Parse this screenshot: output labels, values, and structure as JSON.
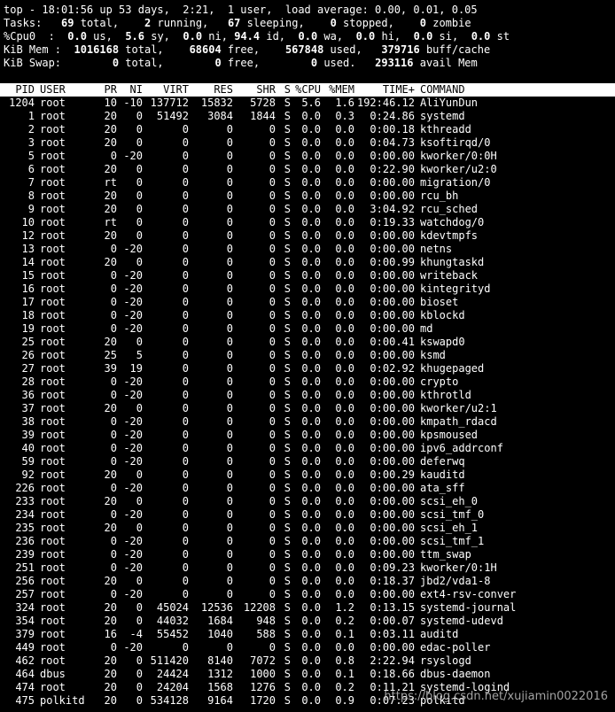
{
  "summary": {
    "line1": "top - 18:01:56 up 53 days,  2:21,  1 user,  load average: 0.00, 0.01, 0.05",
    "tasks": {
      "label": "Tasks:",
      "total": "69",
      "total_label": "total,",
      "running": "2",
      "running_label": "running,",
      "sleeping": "67",
      "sleeping_label": "sleeping,",
      "stopped": "0",
      "stopped_label": "stopped,",
      "zombie": "0",
      "zombie_label": "zombie"
    },
    "cpu": {
      "label": "%Cpu0  :",
      "us": "0.0",
      "us_label": "us,",
      "sy": "5.6",
      "sy_label": "sy,",
      "ni": "0.0",
      "ni_label": "ni,",
      "id": "94.4",
      "id_label": "id,",
      "wa": "0.0",
      "wa_label": "wa,",
      "hi": "0.0",
      "hi_label": "hi,",
      "si": "0.0",
      "si_label": "si,",
      "st": "0.0",
      "st_label": "st"
    },
    "mem": {
      "label": "KiB Mem :",
      "total": "1016168",
      "total_label": "total,",
      "free": "68604",
      "free_label": "free,",
      "used": "567848",
      "used_label": "used,",
      "buff": "379716",
      "buff_label": "buff/cache"
    },
    "swap": {
      "label": "KiB Swap:",
      "total": "0",
      "total_label": "total,",
      "free": "0",
      "free_label": "free,",
      "used": "0",
      "used_label": "used.",
      "avail": "293116",
      "avail_label": "avail Mem"
    }
  },
  "columns": [
    "PID",
    "USER",
    "PR",
    "NI",
    "VIRT",
    "RES",
    "SHR",
    "S",
    "%CPU",
    "%MEM",
    "TIME+",
    "COMMAND"
  ],
  "processes": [
    [
      "1204",
      "root",
      "10",
      "-10",
      "137712",
      "15832",
      "5728",
      "S",
      "5.6",
      "1.6",
      "192:46.12",
      "AliYunDun"
    ],
    [
      "1",
      "root",
      "20",
      "0",
      "51492",
      "3084",
      "1844",
      "S",
      "0.0",
      "0.3",
      "0:24.86",
      "systemd"
    ],
    [
      "2",
      "root",
      "20",
      "0",
      "0",
      "0",
      "0",
      "S",
      "0.0",
      "0.0",
      "0:00.18",
      "kthreadd"
    ],
    [
      "3",
      "root",
      "20",
      "0",
      "0",
      "0",
      "0",
      "S",
      "0.0",
      "0.0",
      "0:04.73",
      "ksoftirqd/0"
    ],
    [
      "5",
      "root",
      "0",
      "-20",
      "0",
      "0",
      "0",
      "S",
      "0.0",
      "0.0",
      "0:00.00",
      "kworker/0:0H"
    ],
    [
      "6",
      "root",
      "20",
      "0",
      "0",
      "0",
      "0",
      "S",
      "0.0",
      "0.0",
      "0:22.90",
      "kworker/u2:0"
    ],
    [
      "7",
      "root",
      "rt",
      "0",
      "0",
      "0",
      "0",
      "S",
      "0.0",
      "0.0",
      "0:00.00",
      "migration/0"
    ],
    [
      "8",
      "root",
      "20",
      "0",
      "0",
      "0",
      "0",
      "S",
      "0.0",
      "0.0",
      "0:00.00",
      "rcu_bh"
    ],
    [
      "9",
      "root",
      "20",
      "0",
      "0",
      "0",
      "0",
      "S",
      "0.0",
      "0.0",
      "3:04.92",
      "rcu_sched"
    ],
    [
      "10",
      "root",
      "rt",
      "0",
      "0",
      "0",
      "0",
      "S",
      "0.0",
      "0.0",
      "0:19.33",
      "watchdog/0"
    ],
    [
      "12",
      "root",
      "20",
      "0",
      "0",
      "0",
      "0",
      "S",
      "0.0",
      "0.0",
      "0:00.00",
      "kdevtmpfs"
    ],
    [
      "13",
      "root",
      "0",
      "-20",
      "0",
      "0",
      "0",
      "S",
      "0.0",
      "0.0",
      "0:00.00",
      "netns"
    ],
    [
      "14",
      "root",
      "20",
      "0",
      "0",
      "0",
      "0",
      "S",
      "0.0",
      "0.0",
      "0:00.99",
      "khungtaskd"
    ],
    [
      "15",
      "root",
      "0",
      "-20",
      "0",
      "0",
      "0",
      "S",
      "0.0",
      "0.0",
      "0:00.00",
      "writeback"
    ],
    [
      "16",
      "root",
      "0",
      "-20",
      "0",
      "0",
      "0",
      "S",
      "0.0",
      "0.0",
      "0:00.00",
      "kintegrityd"
    ],
    [
      "17",
      "root",
      "0",
      "-20",
      "0",
      "0",
      "0",
      "S",
      "0.0",
      "0.0",
      "0:00.00",
      "bioset"
    ],
    [
      "18",
      "root",
      "0",
      "-20",
      "0",
      "0",
      "0",
      "S",
      "0.0",
      "0.0",
      "0:00.00",
      "kblockd"
    ],
    [
      "19",
      "root",
      "0",
      "-20",
      "0",
      "0",
      "0",
      "S",
      "0.0",
      "0.0",
      "0:00.00",
      "md"
    ],
    [
      "25",
      "root",
      "20",
      "0",
      "0",
      "0",
      "0",
      "S",
      "0.0",
      "0.0",
      "0:00.41",
      "kswapd0"
    ],
    [
      "26",
      "root",
      "25",
      "5",
      "0",
      "0",
      "0",
      "S",
      "0.0",
      "0.0",
      "0:00.00",
      "ksmd"
    ],
    [
      "27",
      "root",
      "39",
      "19",
      "0",
      "0",
      "0",
      "S",
      "0.0",
      "0.0",
      "0:02.92",
      "khugepaged"
    ],
    [
      "28",
      "root",
      "0",
      "-20",
      "0",
      "0",
      "0",
      "S",
      "0.0",
      "0.0",
      "0:00.00",
      "crypto"
    ],
    [
      "36",
      "root",
      "0",
      "-20",
      "0",
      "0",
      "0",
      "S",
      "0.0",
      "0.0",
      "0:00.00",
      "kthrotld"
    ],
    [
      "37",
      "root",
      "20",
      "0",
      "0",
      "0",
      "0",
      "S",
      "0.0",
      "0.0",
      "0:00.00",
      "kworker/u2:1"
    ],
    [
      "38",
      "root",
      "0",
      "-20",
      "0",
      "0",
      "0",
      "S",
      "0.0",
      "0.0",
      "0:00.00",
      "kmpath_rdacd"
    ],
    [
      "39",
      "root",
      "0",
      "-20",
      "0",
      "0",
      "0",
      "S",
      "0.0",
      "0.0",
      "0:00.00",
      "kpsmoused"
    ],
    [
      "40",
      "root",
      "0",
      "-20",
      "0",
      "0",
      "0",
      "S",
      "0.0",
      "0.0",
      "0:00.00",
      "ipv6_addrconf"
    ],
    [
      "59",
      "root",
      "0",
      "-20",
      "0",
      "0",
      "0",
      "S",
      "0.0",
      "0.0",
      "0:00.00",
      "deferwq"
    ],
    [
      "92",
      "root",
      "20",
      "0",
      "0",
      "0",
      "0",
      "S",
      "0.0",
      "0.0",
      "0:00.29",
      "kauditd"
    ],
    [
      "226",
      "root",
      "0",
      "-20",
      "0",
      "0",
      "0",
      "S",
      "0.0",
      "0.0",
      "0:00.00",
      "ata_sff"
    ],
    [
      "233",
      "root",
      "20",
      "0",
      "0",
      "0",
      "0",
      "S",
      "0.0",
      "0.0",
      "0:00.00",
      "scsi_eh_0"
    ],
    [
      "234",
      "root",
      "0",
      "-20",
      "0",
      "0",
      "0",
      "S",
      "0.0",
      "0.0",
      "0:00.00",
      "scsi_tmf_0"
    ],
    [
      "235",
      "root",
      "20",
      "0",
      "0",
      "0",
      "0",
      "S",
      "0.0",
      "0.0",
      "0:00.00",
      "scsi_eh_1"
    ],
    [
      "236",
      "root",
      "0",
      "-20",
      "0",
      "0",
      "0",
      "S",
      "0.0",
      "0.0",
      "0:00.00",
      "scsi_tmf_1"
    ],
    [
      "239",
      "root",
      "0",
      "-20",
      "0",
      "0",
      "0",
      "S",
      "0.0",
      "0.0",
      "0:00.00",
      "ttm_swap"
    ],
    [
      "251",
      "root",
      "0",
      "-20",
      "0",
      "0",
      "0",
      "S",
      "0.0",
      "0.0",
      "0:09.23",
      "kworker/0:1H"
    ],
    [
      "256",
      "root",
      "20",
      "0",
      "0",
      "0",
      "0",
      "S",
      "0.0",
      "0.0",
      "0:18.37",
      "jbd2/vda1-8"
    ],
    [
      "257",
      "root",
      "0",
      "-20",
      "0",
      "0",
      "0",
      "S",
      "0.0",
      "0.0",
      "0:00.00",
      "ext4-rsv-conver"
    ],
    [
      "324",
      "root",
      "20",
      "0",
      "45024",
      "12536",
      "12208",
      "S",
      "0.0",
      "1.2",
      "0:13.15",
      "systemd-journal"
    ],
    [
      "354",
      "root",
      "20",
      "0",
      "44032",
      "1684",
      "948",
      "S",
      "0.0",
      "0.2",
      "0:00.07",
      "systemd-udevd"
    ],
    [
      "379",
      "root",
      "16",
      "-4",
      "55452",
      "1040",
      "588",
      "S",
      "0.0",
      "0.1",
      "0:03.11",
      "auditd"
    ],
    [
      "449",
      "root",
      "0",
      "-20",
      "0",
      "0",
      "0",
      "S",
      "0.0",
      "0.0",
      "0:00.00",
      "edac-poller"
    ],
    [
      "462",
      "root",
      "20",
      "0",
      "511420",
      "8140",
      "7072",
      "S",
      "0.0",
      "0.8",
      "2:22.94",
      "rsyslogd"
    ],
    [
      "464",
      "dbus",
      "20",
      "0",
      "24424",
      "1312",
      "1000",
      "S",
      "0.0",
      "0.1",
      "0:18.66",
      "dbus-daemon"
    ],
    [
      "474",
      "root",
      "20",
      "0",
      "24204",
      "1568",
      "1276",
      "S",
      "0.0",
      "0.2",
      "0:11.21",
      "systemd-logind"
    ],
    [
      "475",
      "polkitd",
      "20",
      "0",
      "534128",
      "9164",
      "1720",
      "S",
      "0.0",
      "0.9",
      "0:07.23",
      "polkitd"
    ]
  ],
  "watermark": "https://blog.csdn.net/xujiamin0022016",
  "colors": {
    "background": "#000000",
    "text": "#ffffff",
    "header_bg": "#ffffff",
    "header_text": "#000000"
  }
}
